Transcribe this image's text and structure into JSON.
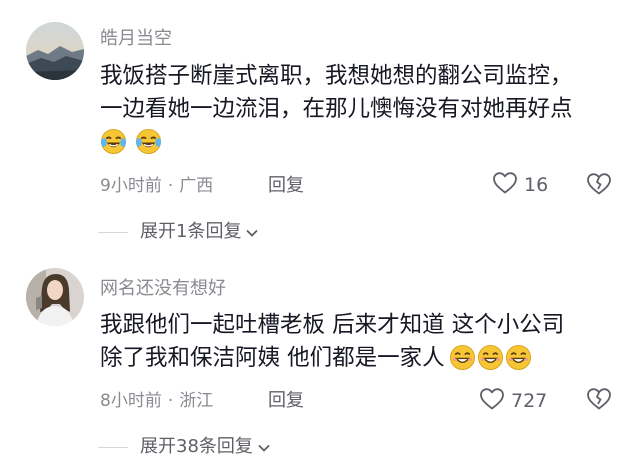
{
  "comments": [
    {
      "username": "皓月当空",
      "lines": [
        "我饭搭子断崖式离职，我想她想的翻公司监控，",
        "一边看她一边流泪，在那儿懊悔没有对她再好点"
      ],
      "emoji": "laughing-crying-emoji",
      "time": "9小时前",
      "location": "广西",
      "reply_label": "回复",
      "likes": "16",
      "expand_label": "展开1条回复"
    },
    {
      "username": "网名还没有想好",
      "lines": [
        "我跟他们一起吐槽老板 后来才知道 这个小公司",
        "除了我和保洁阿姨 他们都是一家人"
      ],
      "emoji": "grin-emoji",
      "time": "8小时前",
      "location": "浙江",
      "reply_label": "回复",
      "likes": "727",
      "expand_label": "展开38条回复"
    }
  ],
  "colors": {
    "text": "#161823",
    "muted": "#8a8b91",
    "action": "#5f6067",
    "emoji_yellow": "#f7c634"
  },
  "icons": [
    "heart-outline-icon",
    "broken-heart-icon",
    "chevron-down-icon"
  ]
}
